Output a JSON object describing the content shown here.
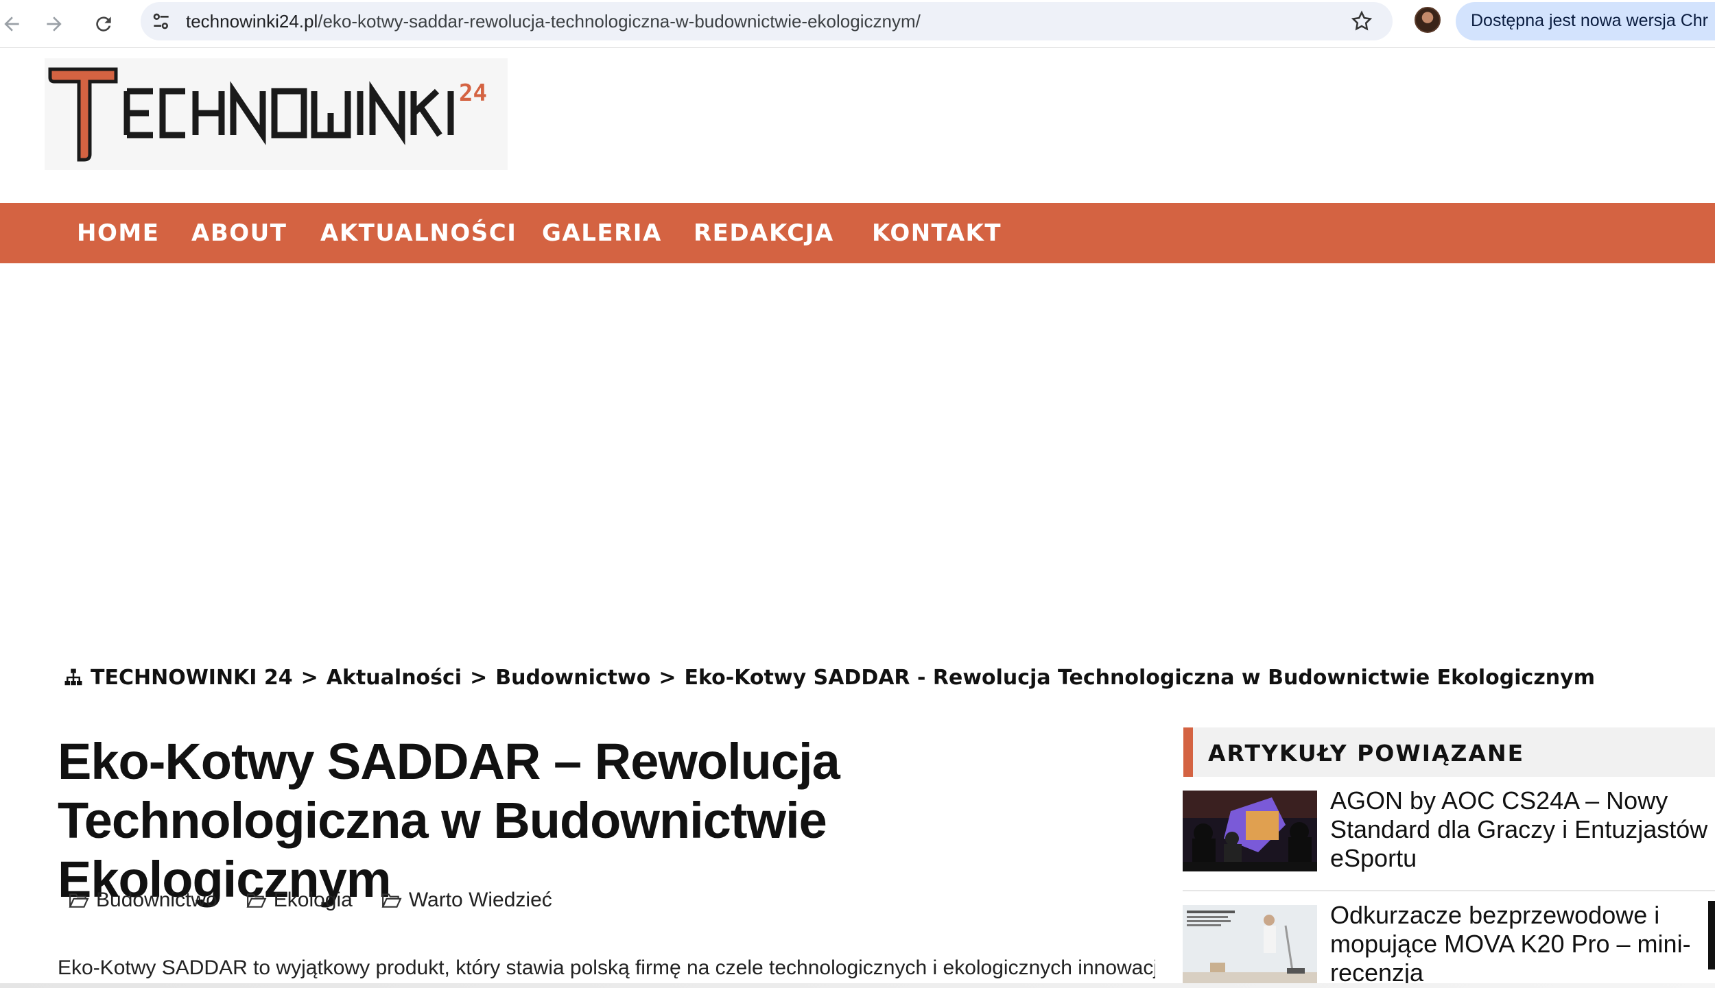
{
  "browser": {
    "url_host": "technowinki24.pl",
    "url_path": "/eko-kotwy-saddar-rewolucja-technologiczna-w-budownictwie-ekologicznym/",
    "update_notice": "Dostępna jest nowa wersja Chr"
  },
  "site": {
    "logo_text": "TECHNOWINKI",
    "logo_superscript": "24"
  },
  "nav": {
    "items": [
      "HOME",
      "ABOUT",
      "AKTUALNOŚCI",
      "GALERIA",
      "REDAKCJA",
      "KONTAKT"
    ]
  },
  "breadcrumb": {
    "home": "TECHNOWINKI 24",
    "level1": "Aktualności",
    "level2": "Budownictwo",
    "current": "Eko-Kotwy SADDAR - Rewolucja Technologiczna w Budownictwie Ekologicznym",
    "separator": ">"
  },
  "article": {
    "title": "Eko-Kotwy SADDAR – Rewolucja Technologiczna w Budownictwie Ekologicznym",
    "categories": [
      "Budownictwo",
      "Ekologia",
      "Warto Wiedzieć"
    ],
    "intro": "Eko-Kotwy SADDAR to wyjątkowy produkt, który stawia polską firmę na czele technologicznych i ekologicznych innowacji"
  },
  "sidebar": {
    "heading": "ARTYKUŁY POWIĄZANE",
    "related": [
      {
        "title": "AGON by AOC CS24A – Nowy Standard dla Graczy i Entuzjastów eSportu"
      },
      {
        "title": "Odkurzacze bezprzewodowe i mopujące MOVA K20 Pro – mini-recenzja"
      }
    ]
  },
  "colors": {
    "accent": "#d46342",
    "nav_text": "#ffffff",
    "omnibox_bg": "#eef1f8",
    "update_pill_bg": "#d3e3fd"
  }
}
